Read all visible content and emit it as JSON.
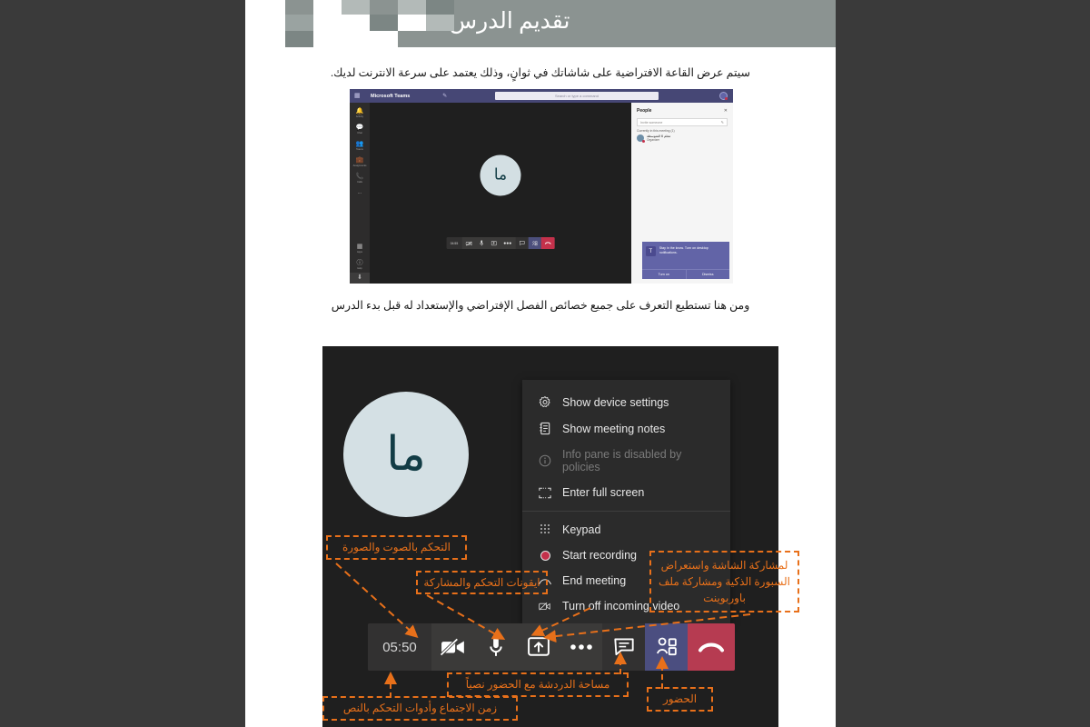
{
  "slide": {
    "title": "تقديم الدرس",
    "paragraph1": "سيتم عرض القاعة الافتراضية على شاشاتك في ثوانٍ، وذلك يعتمد على سرعة الانترنت لديك.",
    "paragraph2": "ومن هنا تستطيع التعرف على جميع خصائص الفصل الإفتراضي  والإستعداد له قبل بدء الدرس"
  },
  "colors": {
    "header_band": "#8b9391",
    "annotation": "#e8701a",
    "teams_purple": "#464775",
    "hangup_red": "#b63b51",
    "people_blue": "#4b4e80",
    "avatar_bg": "#d4e0e4",
    "avatar_text": "#123c45",
    "stage_bg": "#1f1f1f",
    "menu_bg": "#2b2b2b",
    "page_bg": "#3a3a3a"
  },
  "screenshot_small": {
    "app_name": "Microsoft Teams",
    "search_placeholder": "Search or type a command",
    "compose_icon": "compose-icon",
    "grid_icon": "app-grid-icon",
    "avatar_initials": "ما",
    "rail": [
      {
        "label": "Activity",
        "icon": "bell-icon"
      },
      {
        "label": "Chat",
        "icon": "chat-icon"
      },
      {
        "label": "Teams",
        "icon": "teams-icon"
      },
      {
        "label": "Assignments",
        "icon": "assignments-icon"
      },
      {
        "label": "Calls",
        "icon": "phone-icon"
      },
      {
        "label": "",
        "icon": "more-icon"
      }
    ],
    "rail_bottom": [
      {
        "label": "Apps",
        "icon": "apps-icon"
      },
      {
        "label": "Help",
        "icon": "help-icon"
      },
      {
        "label": "",
        "icon": "download-icon"
      }
    ],
    "meeting_bar": {
      "timer": "04:55",
      "controls": [
        "camera-off-icon",
        "microphone-icon",
        "share-screen-icon",
        "more-icon",
        "chat-icon",
        "people-icon",
        "hangup-icon"
      ]
    },
    "people_panel": {
      "title": "People",
      "close_icon": "close-icon",
      "invite_placeholder": "Invite someone",
      "invite_action_icon": "add-person-icon",
      "section": "Currently in this meeting (1)",
      "person_name": "معلم 6 المتوسطة",
      "person_role": "Organizer"
    },
    "toast": {
      "logo": "T",
      "message": "Stay in the know. Turn on desktop notifications.",
      "primary": "Turn on",
      "secondary": "Dismiss"
    }
  },
  "screenshot_large": {
    "avatar_initials": "ما",
    "menu_items": [
      {
        "label": "Show device settings",
        "icon": "gear-icon",
        "disabled": false
      },
      {
        "label": "Show meeting notes",
        "icon": "notes-icon",
        "disabled": false
      },
      {
        "label": "Info pane is disabled by policies",
        "icon": "info-icon",
        "disabled": true
      },
      {
        "label": "Enter full screen",
        "icon": "fullscreen-icon",
        "disabled": false
      }
    ],
    "menu_items2": [
      {
        "label": "Keypad",
        "icon": "keypad-icon",
        "disabled": false
      },
      {
        "label": "Start recording",
        "icon": "record-icon",
        "disabled": false
      },
      {
        "label": "End meeting",
        "icon": "end-meeting-icon",
        "disabled": false
      },
      {
        "label": "Turn off incoming video",
        "icon": "video-off-icon",
        "disabled": false
      }
    ],
    "toolbar": {
      "timer": "05:50",
      "camera": "camera-off-icon",
      "microphone": "microphone-icon",
      "share": "share-screen-icon",
      "more": "more-options-icon",
      "chat": "chat-icon",
      "people": "people-icon",
      "hangup": "hangup-icon"
    }
  },
  "annotations": [
    {
      "id": "audio-video-control",
      "text": "التحكم بالصوت والصورة"
    },
    {
      "id": "control-share-icons",
      "text": "ايقونات التحكم والمشاركة"
    },
    {
      "id": "screen-share-whiteboard",
      "text": "لمشاركة الشاشة واستعراض السبورة الذكية ومشاركة ملف باوربوينت"
    },
    {
      "id": "chat-with-attendees",
      "text": "مساحة الدردشة مع الحضور نصياً"
    },
    {
      "id": "attendees",
      "text": "الحضور"
    },
    {
      "id": "meeting-time-text-tools",
      "text": "زمن الاجتماع وأدوات التحكم بالنص"
    }
  ]
}
